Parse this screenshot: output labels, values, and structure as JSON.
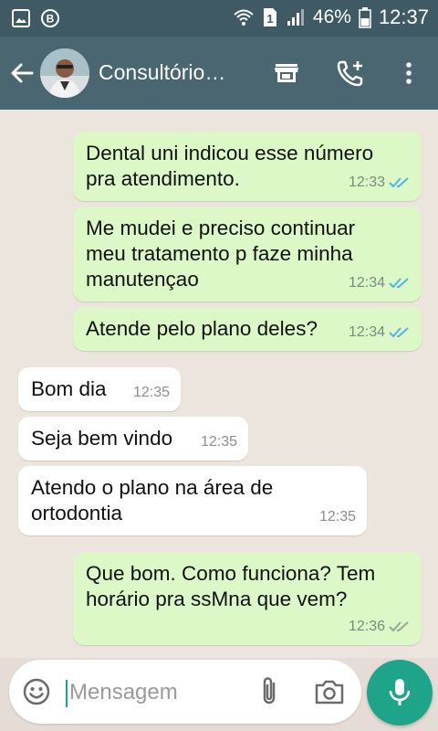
{
  "status_bar": {
    "battery_percent": "46%",
    "time": "12:37",
    "sim_slot": "1",
    "icons": [
      "image-notification-icon",
      "b-notification-icon",
      "wifi-icon",
      "sim-icon",
      "signal-icon",
      "battery-icon"
    ]
  },
  "header": {
    "title": "Consultório…",
    "icons": [
      "back-arrow-icon",
      "contact-avatar",
      "store-icon",
      "add-call-icon",
      "more-options-icon"
    ]
  },
  "messages": [
    {
      "direction": "out",
      "text_lines": [
        "Dental uni indicou esse número",
        "pra atendimento."
      ],
      "time": "12:33",
      "status": "read"
    },
    {
      "direction": "out",
      "text_lines": [
        "Me mudei e preciso continuar",
        "meu tratamento p faze minha",
        "manutençao"
      ],
      "time": "12:34",
      "status": "read"
    },
    {
      "direction": "out",
      "text_lines": [
        "Atende pelo plano deles?"
      ],
      "time": "12:34",
      "status": "read"
    },
    {
      "direction": "in",
      "text_lines": [
        "Bom dia"
      ],
      "time": "12:35"
    },
    {
      "direction": "in",
      "text_lines": [
        "Seja bem vindo"
      ],
      "time": "12:35"
    },
    {
      "direction": "in",
      "text_lines": [
        "Atendo o plano na área de",
        "ortodontia"
      ],
      "time": "12:35"
    },
    {
      "direction": "out",
      "text_lines": [
        "Que bom. Como funciona? Tem",
        "horário pra ssMna que vem?"
      ],
      "time": "12:36",
      "status": "delivered"
    }
  ],
  "input": {
    "placeholder": "Mensagem"
  },
  "colors": {
    "header": "#4a6670",
    "status_bar": "#3f5a64",
    "outgoing_bubble": "#dcf8c6",
    "incoming_bubble": "#ffffff",
    "read_tick": "#4fb3e8",
    "accent": "#1ea589"
  }
}
